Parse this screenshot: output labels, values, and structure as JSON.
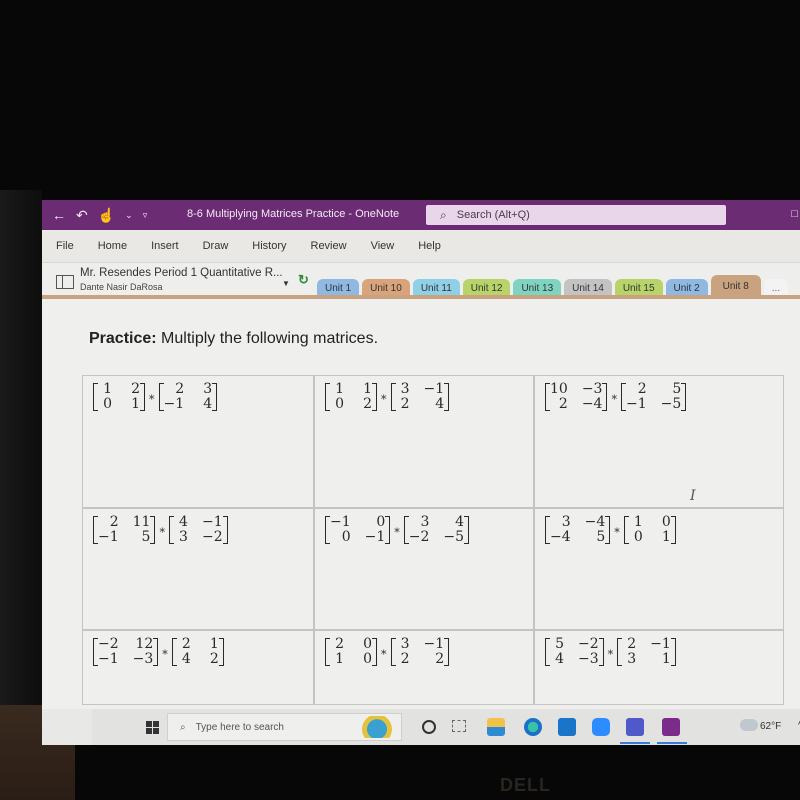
{
  "window": {
    "title": "8-6 Multiplying Matrices Practice  -  OneNote",
    "search_placeholder": "Search (Alt+Q)"
  },
  "menu": [
    "File",
    "Home",
    "Insert",
    "Draw",
    "History",
    "Review",
    "View",
    "Help"
  ],
  "notebook": {
    "name": "Mr. Resendes Period 1 Quantitative R...",
    "user": "Dante Nasir DaRosa"
  },
  "sections": [
    {
      "label": "Unit 1",
      "color": "#8fb8e3",
      "active": false
    },
    {
      "label": "Unit 10",
      "color": "#d9a47c",
      "active": false
    },
    {
      "label": "Unit 11",
      "color": "#8fd0e6",
      "active": false
    },
    {
      "label": "Unit 12",
      "color": "#b7d36a",
      "active": false
    },
    {
      "label": "Unit 13",
      "color": "#7fd4c1",
      "active": false
    },
    {
      "label": "Unit 14",
      "color": "#c3c3c3",
      "active": false
    },
    {
      "label": "Unit 15",
      "color": "#b7d36a",
      "active": false
    },
    {
      "label": "Unit 2",
      "color": "#8fb8e3",
      "active": false
    },
    {
      "label": "Unit 8",
      "color": "#c9a27f",
      "active": true
    }
  ],
  "more_tabs": "...",
  "page": {
    "heading_bold": "Practice:",
    "heading_text": " Multiply the following matrices.",
    "operator": "*",
    "problems": [
      {
        "a": [
          [
            "1",
            "2"
          ],
          [
            "0",
            "1"
          ]
        ],
        "b": [
          [
            "2",
            "3"
          ],
          [
            "−1",
            "4"
          ]
        ]
      },
      {
        "a": [
          [
            "1",
            "1"
          ],
          [
            "0",
            "2"
          ]
        ],
        "b": [
          [
            "3",
            "−1"
          ],
          [
            "2",
            "4"
          ]
        ]
      },
      {
        "a": [
          [
            "10",
            "−3"
          ],
          [
            "2",
            "−4"
          ]
        ],
        "b": [
          [
            "2",
            "5"
          ],
          [
            "−1",
            "−5"
          ]
        ]
      },
      {
        "a": [
          [
            "2",
            "11"
          ],
          [
            "−1",
            "5"
          ]
        ],
        "b": [
          [
            "4",
            "−1"
          ],
          [
            "3",
            "−2"
          ]
        ]
      },
      {
        "a": [
          [
            "−1",
            "0"
          ],
          [
            "0",
            "−1"
          ]
        ],
        "b": [
          [
            "3",
            "4"
          ],
          [
            "−2",
            "−5"
          ]
        ]
      },
      {
        "a": [
          [
            "3",
            "−4"
          ],
          [
            "−4",
            "5"
          ]
        ],
        "b": [
          [
            "1",
            "0"
          ],
          [
            "0",
            "1"
          ]
        ]
      },
      {
        "a": [
          [
            "−2",
            "12"
          ],
          [
            "−1",
            "−3"
          ]
        ],
        "b": [
          [
            "2",
            "1"
          ],
          [
            "4",
            "2"
          ]
        ]
      },
      {
        "a": [
          [
            "2",
            "0"
          ],
          [
            "1",
            "0"
          ]
        ],
        "b": [
          [
            "3",
            "−1"
          ],
          [
            "2",
            "2"
          ]
        ]
      },
      {
        "a": [
          [
            "5",
            "−2"
          ],
          [
            "4",
            "−3"
          ]
        ],
        "b": [
          [
            "2",
            "−1"
          ],
          [
            "3",
            "1"
          ]
        ]
      }
    ]
  },
  "taskbar": {
    "search_placeholder": "Type here to search",
    "apps": [
      "cortana",
      "task-view",
      "file-explorer",
      "edge",
      "mail",
      "zoom",
      "teams",
      "onenote"
    ],
    "temperature": "62°F",
    "tray_caret": "^"
  },
  "brand": "DELL"
}
